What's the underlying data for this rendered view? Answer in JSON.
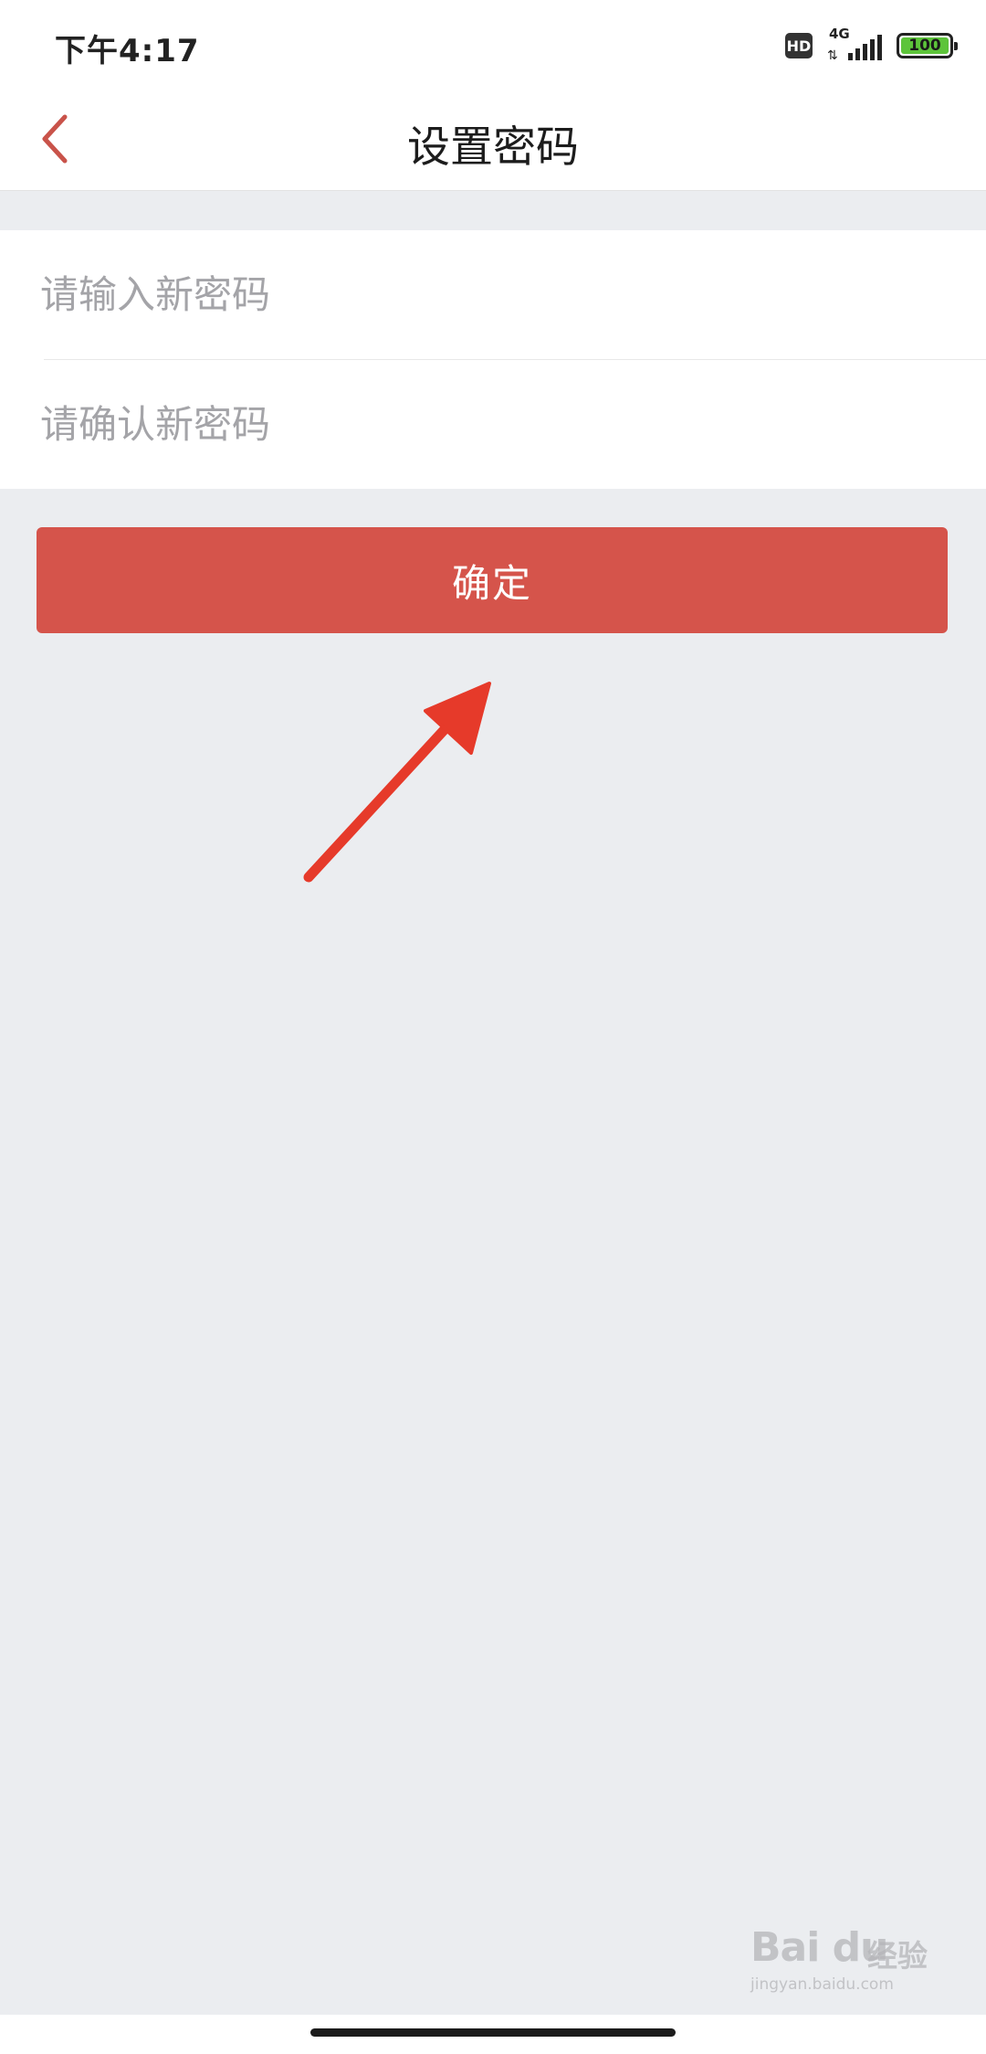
{
  "status_bar": {
    "time": "下午4:17",
    "hd_label": "HD",
    "network_label": "4G",
    "battery_level": "100"
  },
  "nav": {
    "title": "设置密码",
    "back_icon": "chevron-left-icon",
    "accent_color": "#c9534a"
  },
  "form": {
    "new_password_placeholder": "请输入新密码",
    "confirm_password_placeholder": "请确认新密码"
  },
  "confirm_button": {
    "label": "确定",
    "color": "#d5544b"
  },
  "watermark": {
    "logo": "Bai du",
    "text": "经验",
    "url": "jingyan.baidu.com"
  }
}
